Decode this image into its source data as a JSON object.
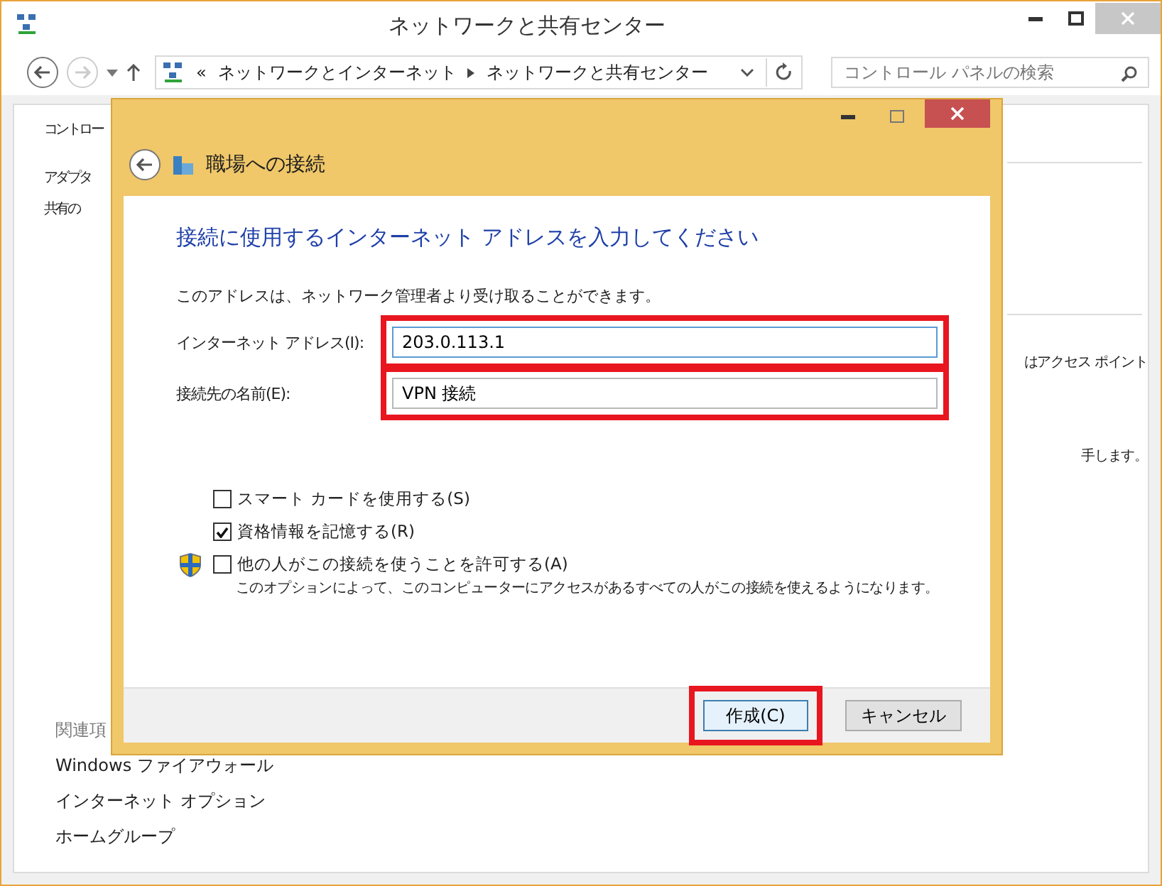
{
  "window": {
    "title": "ネットワークと共有センター"
  },
  "nav": {
    "prefix": "«",
    "breadcrumb": [
      "ネットワークとインターネット",
      "ネットワークと共有センター"
    ],
    "search_placeholder": "コントロール パネルの検索"
  },
  "sidebar": {
    "items": [
      "コントロー",
      "アダプタ",
      "共有の"
    ],
    "related_heading": "関連項",
    "related": [
      "Windows ファイアウォール",
      "インターネット オプション",
      "ホームグループ"
    ]
  },
  "main_fragments": [
    "はアクセス ポイント",
    "手します。"
  ],
  "dialog": {
    "title": "職場への接続",
    "heading": "接続に使用するインターネット アドレスを入力してください",
    "description": "このアドレスは、ネットワーク管理者より受け取ることができます。",
    "fields": [
      {
        "label": "インターネット アドレス(I):",
        "value": "203.0.113.1",
        "focused": true,
        "highlighted": true
      },
      {
        "label": "接続先の名前(E):",
        "value": "VPN 接続",
        "focused": false,
        "highlighted": true
      }
    ],
    "options": [
      {
        "label": "スマート カードを使用する(S)",
        "checked": false,
        "shield": false
      },
      {
        "label": "資格情報を記憶する(R)",
        "checked": true,
        "shield": false
      },
      {
        "label": "他の人がこの接続を使うことを許可する(A)",
        "checked": false,
        "shield": true,
        "note": "このオプションによって、このコンピューターにアクセスがあるすべての人がこの接続を使えるようになります。"
      }
    ],
    "buttons": [
      {
        "label": "作成(C)",
        "default": true,
        "highlighted": true
      },
      {
        "label": "キャンセル",
        "default": false,
        "highlighted": false
      }
    ]
  }
}
